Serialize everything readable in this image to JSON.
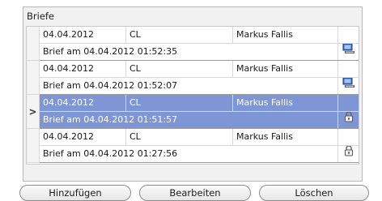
{
  "panel": {
    "title": "Briefe"
  },
  "records": [
    {
      "date": "04.04.2012",
      "user": "CL",
      "name": "Markus Fallis",
      "description": "Brief am 04.04.2012 01:52:35",
      "icon": "computer-icon",
      "selected": false
    },
    {
      "date": "04.04.2012",
      "user": "CL",
      "name": "Markus Fallis",
      "description": "Brief am 04.04.2012 01:52:07",
      "icon": "computer-icon",
      "selected": false
    },
    {
      "date": "04.04.2012",
      "user": "CL",
      "name": "Markus Fallis",
      "description": "Brief am 04.04.2012 01:51:57",
      "icon": "lock-icon",
      "selected": true
    },
    {
      "date": "04.04.2012",
      "user": "CL",
      "name": "Markus Fallis",
      "description": "Brief am 04.04.2012 01:27:56",
      "icon": "lock-icon",
      "selected": false
    }
  ],
  "current_row_indicator": ">",
  "buttons": {
    "add": "Hinzufügen",
    "edit": "Bearbeiten",
    "delete": "Löschen"
  },
  "colors": {
    "selection": "#7f96d6",
    "panel_bg": "#f1f1f1"
  }
}
